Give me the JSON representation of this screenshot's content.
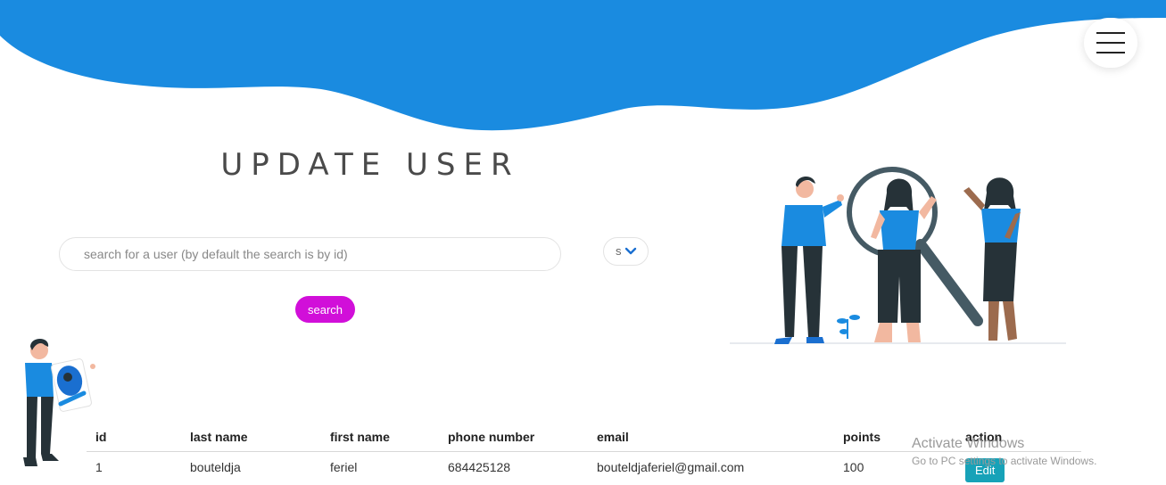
{
  "header": {
    "brand_color": "#1a8be0",
    "menu_icon": "hamburger-icon"
  },
  "page": {
    "title": "UPDATE USER"
  },
  "search": {
    "placeholder": "search for a user (by default the search is by id)",
    "value": "",
    "select_value": "s",
    "select_icon": "chevron-down-icon",
    "button_label": "search",
    "button_color": "#d10fd9"
  },
  "table": {
    "headers": [
      "id",
      "last name",
      "first name",
      "phone number",
      "email",
      "points",
      "action"
    ],
    "rows": [
      {
        "id": "1",
        "last_name": "bouteldja",
        "first_name": "feriel",
        "phone": "684425128",
        "email": "bouteldjaferiel@gmail.com",
        "points": "100",
        "action_label": "Edit"
      }
    ],
    "action_color": "#17a2b8"
  },
  "watermark": {
    "title": "Activate Windows",
    "subtitle": "Go to PC settings to activate Windows."
  }
}
